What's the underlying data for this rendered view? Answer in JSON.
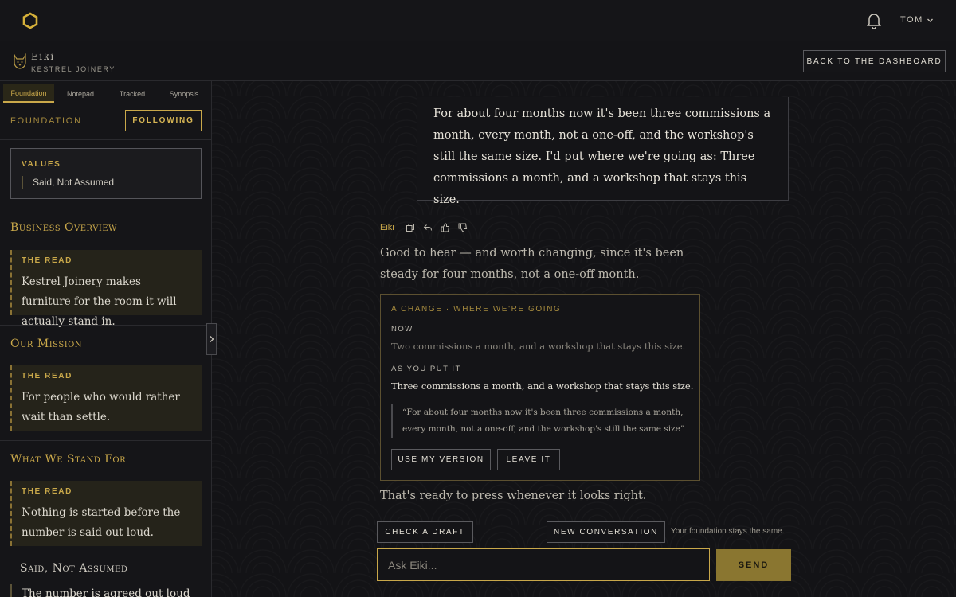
{
  "topbar": {
    "user": "TOM",
    "icons": [
      "hexagon-logo-icon",
      "bell-icon",
      "chevron-down-icon"
    ]
  },
  "agent": {
    "name": "Eiki",
    "company": "KESTREL JOINERY",
    "back_label": "BACK TO THE DASHBOARD"
  },
  "sidebar": {
    "tabs": [
      {
        "label": "Foundation",
        "active": true
      },
      {
        "label": "Notepad",
        "active": false
      },
      {
        "label": "Tracked",
        "active": false
      },
      {
        "label": "Synopsis",
        "active": false
      }
    ],
    "foundation_label": "FOUNDATION",
    "following_label": "FOLLOWING",
    "values": {
      "title": "VALUES",
      "text": "Said, Not Assumed"
    },
    "sections": [
      {
        "heading": "Business Overview",
        "read_title": "THE READ",
        "read_text": "Kestrel Joinery makes furniture for the room it will actually stand in."
      },
      {
        "heading": "Our Mission",
        "read_title": "THE READ",
        "read_text": "For people who would rather wait than settle."
      },
      {
        "heading": "What We Stand For",
        "read_title": "THE READ",
        "read_text": "Nothing is started before the number is said out loud."
      }
    ],
    "last_section": {
      "heading": "Said, Not Assumed",
      "text": "The number is agreed out loud before"
    }
  },
  "chat": {
    "user_message": "For about four months now it's been three commissions a month, every month, not a one-off, and the workshop's still the same size. I'd put where we're going as: Three commissions a month, and a workshop that stays this size.",
    "assistant_name": "Eiki",
    "assistant_icons": [
      "copy-icon",
      "reply-icon",
      "thumbs-up-icon",
      "thumbs-down-icon"
    ],
    "reply": "Good to hear — and worth changing, since it's been steady for four months, not a one-off month.",
    "change_card": {
      "title": "A CHANGE · WHERE WE'RE GOING",
      "now_label": "NOW",
      "now_text": "Two commissions a month, and a workshop that stays this size.",
      "yours_label": "AS YOU PUT IT",
      "yours_text": "Three commissions a month, and a workshop that stays this size.",
      "quote": "“For about four months now it's been three commissions a month, every month, not a one-off, and the workshop's still the same size”",
      "use_label": "USE MY VERSION",
      "leave_label": "LEAVE IT"
    },
    "ready_text": "That's ready to press whenever it looks right."
  },
  "composer": {
    "check_label": "CHECK A DRAFT",
    "new_label": "NEW CONVERSATION",
    "note": "Your foundation stays the same.",
    "placeholder": "Ask Eiki...",
    "send_label": "SEND"
  },
  "colors": {
    "accent": "#c9a84a",
    "background": "#131316"
  }
}
